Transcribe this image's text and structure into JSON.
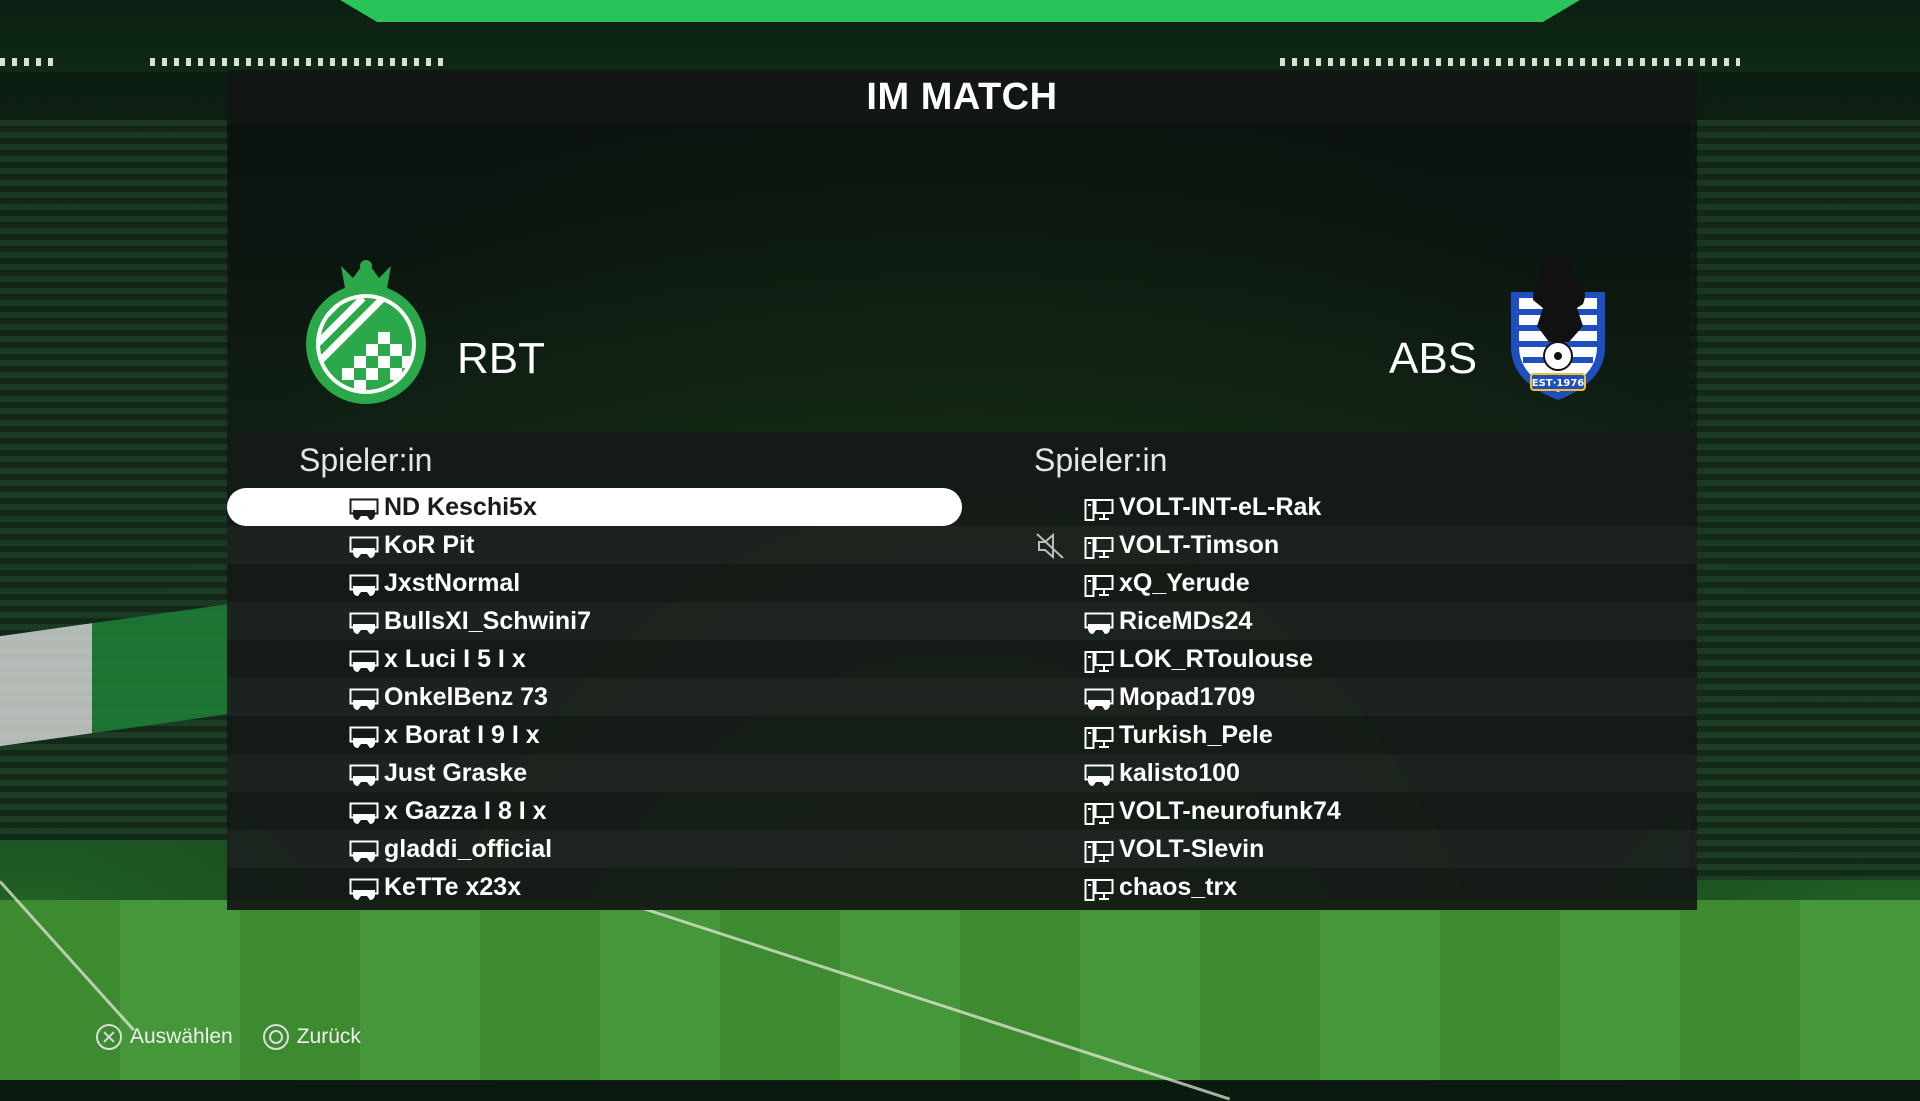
{
  "screen_title": "IM MATCH",
  "home_team": {
    "name": "RBT",
    "crest_icon": "green-white-checkered-crest-with-crown"
  },
  "away_team": {
    "name": "ABS",
    "crest_icon": "blue-white-bear-crest-est-1976",
    "crest_text": "EST·1976"
  },
  "home_players": {
    "header": "Spieler:in",
    "rows": [
      {
        "name": "ND Keschi5x",
        "platform": "controller",
        "selected": true
      },
      {
        "name": "KoR Pit",
        "platform": "controller"
      },
      {
        "name": "JxstNormal",
        "platform": "controller"
      },
      {
        "name": "BullsXI_Schwini7",
        "platform": "controller"
      },
      {
        "name": "x Luci I 5 I x",
        "platform": "controller"
      },
      {
        "name": "OnkelBenz 73",
        "platform": "controller"
      },
      {
        "name": "x Borat I 9 I x",
        "platform": "controller"
      },
      {
        "name": "Just Graske",
        "platform": "controller"
      },
      {
        "name": "x Gazza I 8 I x",
        "platform": "controller"
      },
      {
        "name": "gladdi_official",
        "platform": "controller"
      },
      {
        "name": "KeTTe x23x",
        "platform": "controller"
      }
    ]
  },
  "away_players": {
    "header": "Spieler:in",
    "rows": [
      {
        "name": "VOLT-INT-eL-Rak",
        "platform": "pc"
      },
      {
        "name": "VOLT-Timson",
        "platform": "pc",
        "muted": true
      },
      {
        "name": "xQ_Yerude",
        "platform": "pc"
      },
      {
        "name": "RiceMDs24",
        "platform": "controller"
      },
      {
        "name": "LOK_RToulouse",
        "platform": "pc"
      },
      {
        "name": "Mopad1709",
        "platform": "controller"
      },
      {
        "name": "Turkish_Pele",
        "platform": "pc"
      },
      {
        "name": "kalisto100",
        "platform": "controller"
      },
      {
        "name": "VOLT-neurofunk74",
        "platform": "pc"
      },
      {
        "name": "VOLT-Slevin",
        "platform": "pc"
      },
      {
        "name": "chaos_trx",
        "platform": "pc"
      }
    ]
  },
  "footer": {
    "select_label": "Auswählen",
    "select_icon": "cross-button-icon",
    "back_label": "Zurück",
    "back_icon": "circle-button-icon"
  },
  "colors": {
    "accent_green": "#29c35a",
    "panel_dark": "#141816",
    "selected_row": "#ffffff",
    "away_crest_blue": "#1f4fbf"
  }
}
